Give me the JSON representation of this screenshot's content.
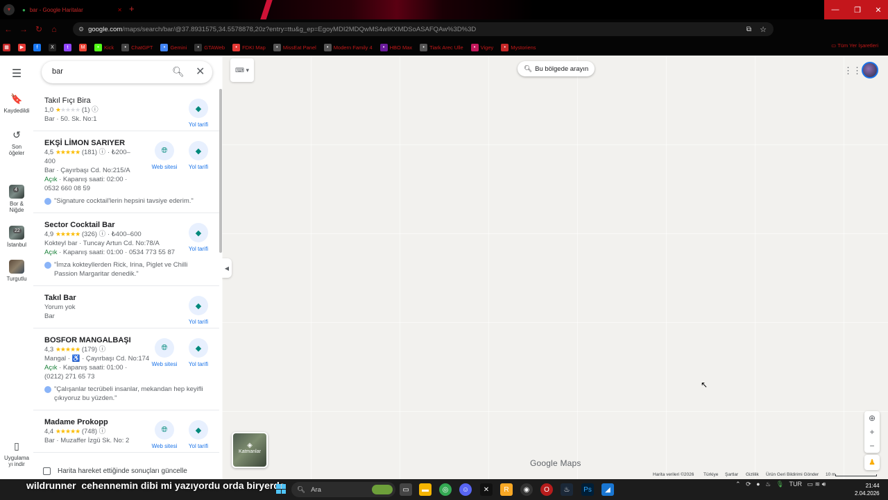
{
  "browser": {
    "tab_title": "bar - Google Haritalar",
    "url_host": "google.com",
    "url_rest": "/maps/search/bar/@37.8931575,34.5578878,20z?entry=ttu&g_ep=EgoyMDI2MDQwMS4wIKXMDSoASAFQAw%3D%3D",
    "bookmarks": [
      {
        "label": "Kick",
        "icon": "kick-icon",
        "color": "#53fc18"
      },
      {
        "label": "ChatGPT",
        "icon": "chatgpt-icon",
        "color": "#444"
      },
      {
        "label": "Gemini",
        "icon": "gemini-icon",
        "color": "#4285f4"
      },
      {
        "label": "GTAWeb",
        "icon": "gta-icon",
        "color": "#333"
      },
      {
        "label": "FDKI Map",
        "icon": "map-pin-icon",
        "color": "#e53935"
      },
      {
        "label": "MissEat Panel",
        "icon": "panel-icon",
        "color": "#555"
      },
      {
        "label": "Modern Family 4",
        "icon": "tv-icon",
        "color": "#555"
      },
      {
        "label": "HBO Max",
        "icon": "hbo-icon",
        "color": "#6a1b9a"
      },
      {
        "label": "Tiark Arec Ulle",
        "icon": "globe-icon",
        "color": "#555"
      },
      {
        "label": "Vigey",
        "icon": "vigey-icon",
        "color": "#c2185b"
      },
      {
        "label": "Mystoriens",
        "icon": "mystoriens-icon",
        "color": "#c62828"
      }
    ],
    "all_bookmarks": "Tüm Yer İşaretleri"
  },
  "rail": {
    "saved": "Kaydedildi",
    "recent_line1": "Son",
    "recent_line2": "öğeler",
    "places": [
      {
        "line1": "Bor &",
        "line2": "Niğde",
        "badge": "4"
      },
      {
        "line1": "İstanbul",
        "line2": "",
        "badge": "22"
      },
      {
        "line1": "Turgutlu",
        "line2": "",
        "badge": ""
      }
    ],
    "app_line1": "Uygulama",
    "app_line2": "yı indir"
  },
  "search": {
    "query": "bar"
  },
  "results": [
    {
      "name": "Takıl Fıçı Bira",
      "bold": false,
      "rating": "1,0",
      "stars_on": 1,
      "reviews": "(1)",
      "price": "",
      "line2": "Bar · 50. Sk. No:1",
      "open": "",
      "hours": "",
      "phone": "",
      "review": "",
      "website": false
    },
    {
      "name": "EKŞİ LİMON SARIYER",
      "bold": true,
      "rating": "4,5",
      "stars_on": 4.5,
      "reviews": "(181)",
      "price": " · ₺200–",
      "price2": "400",
      "line2": "Bar · Çayırbaşı Cd. No:215/A",
      "open": "Açık",
      "hours": " · Kapanış saati: 02:00 ·",
      "phone": "0532 660 08 59",
      "review": "\"Signature cocktail'lerin hepsini tavsiye ederim.\"",
      "website": true
    },
    {
      "name": "Sector Cocktail Bar",
      "bold": true,
      "rating": "4,9",
      "stars_on": 5,
      "reviews": "(326)",
      "price": " · ₺400–600",
      "line2": "Kokteyl bar · Tuncay Artun Cd. No:78/A",
      "open": "Açık",
      "hours": " · Kapanış saati: 01:00 · 0534 773 55 87",
      "phone": "",
      "review": "\"İmza kokteyllerden Rick, Irina, Piglet ve Chilli Passion Margaritar denedik.\"",
      "website": false
    },
    {
      "name": "Takıl Bar",
      "bold": true,
      "rating": "",
      "no_reviews": "Yorum yok",
      "line2": "Bar",
      "open": "",
      "hours": "",
      "phone": "",
      "review": "",
      "website": false
    },
    {
      "name": "BOSFOR MANGALBAŞI",
      "bold": true,
      "rating": "4,3",
      "stars_on": 4.5,
      "reviews": "(179)",
      "price": "",
      "line2": "Mangal · ♿ · Çayırbaşı Cd. No:174",
      "open": "Açık",
      "hours": " · Kapanış saati: 01:00 ·",
      "phone": "(0212) 271 65 73",
      "review": "\"Çalışanlar tecrübeli insanlar, mekandan hep keyifli çıkıyoruz bu yüzden.\"",
      "website": true
    },
    {
      "name": "Madame Prokopp",
      "bold": true,
      "rating": "4,4",
      "stars_on": 4.5,
      "reviews": "(748)",
      "price": "",
      "line2": "Bar · Muzaffer İzgü Sk. No: 2",
      "open": "",
      "hours": "",
      "phone": "",
      "review": "",
      "website": true
    }
  ],
  "actions": {
    "website": "Web sitesi",
    "directions": "Yol tarifi"
  },
  "update_results": "Harita hareket ettiğinde sonuçları güncelle",
  "map": {
    "area_search": "Bu bölgede arayın",
    "layers": "Katmanlar",
    "logo_google": "Google",
    "logo_maps": "Maps",
    "footer": [
      "Harita verileri ©2026",
      "Türkiye",
      "Şartlar",
      "Gizlilik",
      "Ürün Geri Bildirimi Gönder",
      "10 m"
    ]
  },
  "taskbar": {
    "caption_user": "wildrunner",
    "caption_text": "cehennemin dibi mi yazıyordu orda biryerde",
    "search_placeholder": "Ara",
    "lang": "TUR",
    "time": "21:44",
    "date": "2.04.2026",
    "notif_badge": "99+"
  },
  "colors": {
    "accent": "#1a73e8",
    "open": "#188038",
    "star": "#fbbc04",
    "browser_red": "#c62828"
  }
}
